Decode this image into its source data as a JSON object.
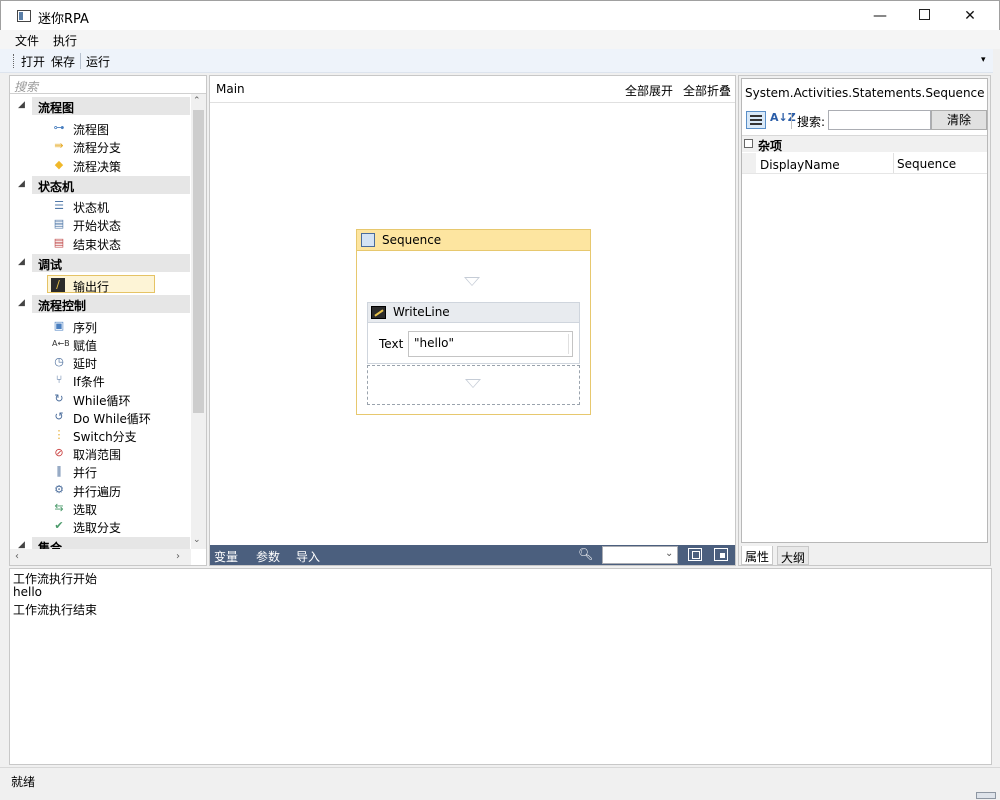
{
  "window": {
    "title": "迷你RPA",
    "minimize_glyph": "—",
    "close_glyph": "✕"
  },
  "menu": {
    "file": "文件",
    "run": "执行"
  },
  "toolbar": {
    "open": "打开",
    "save": "保存",
    "run": "运行",
    "overflow": "▾"
  },
  "toolbox": {
    "search_placeholder": "搜索",
    "categories": [
      {
        "label": "流程图",
        "items": [
          {
            "label": "流程图",
            "icon": "flowchart-icon"
          },
          {
            "label": "流程分支",
            "icon": "flow-switch-icon"
          },
          {
            "label": "流程决策",
            "icon": "flow-decision-icon"
          }
        ]
      },
      {
        "label": "状态机",
        "items": [
          {
            "label": "状态机",
            "icon": "state-machine-icon"
          },
          {
            "label": "开始状态",
            "icon": "start-state-icon"
          },
          {
            "label": "结束状态",
            "icon": "final-state-icon"
          }
        ]
      },
      {
        "label": "调试",
        "items": [
          {
            "label": "输出行",
            "icon": "writeline-icon",
            "selected": true
          }
        ]
      },
      {
        "label": "流程控制",
        "items": [
          {
            "label": "序列",
            "icon": "sequence-icon"
          },
          {
            "label": "赋值",
            "icon": "assign-icon"
          },
          {
            "label": "延时",
            "icon": "delay-icon"
          },
          {
            "label": "If条件",
            "icon": "if-icon"
          },
          {
            "label": "While循环",
            "icon": "while-icon"
          },
          {
            "label": "Do While循环",
            "icon": "do-while-icon"
          },
          {
            "label": "Switch分支",
            "icon": "switch-icon"
          },
          {
            "label": "取消范围",
            "icon": "cancel-scope-icon"
          },
          {
            "label": "并行",
            "icon": "parallel-icon"
          },
          {
            "label": "并行遍历",
            "icon": "parallel-foreach-icon"
          },
          {
            "label": "选取",
            "icon": "pick-icon"
          },
          {
            "label": "选取分支",
            "icon": "pick-branch-icon"
          }
        ]
      },
      {
        "label": "集合",
        "items": []
      }
    ]
  },
  "designer": {
    "breadcrumb": "Main",
    "expand_all": "全部展开",
    "collapse_all": "全部折叠",
    "sequence": {
      "title": "Sequence",
      "writeline": {
        "title": "WriteLine",
        "text_label": "Text",
        "text_value": "\"hello\""
      }
    },
    "footer": {
      "variables": "变量",
      "arguments": "参数",
      "imports": "导入",
      "zoom_value": ""
    }
  },
  "properties": {
    "title": "System.Activities.Statements.Sequence",
    "search_label": "搜索:",
    "search_value": "",
    "clear_button": "清除",
    "category": "杂项",
    "category_toggle": "⊟",
    "rows": [
      {
        "name": "DisplayName",
        "value": "Sequence"
      }
    ],
    "tabs": {
      "properties": "属性",
      "outline": "大纲"
    }
  },
  "output": {
    "lines": [
      "工作流执行开始",
      "hello",
      "工作流执行结束"
    ]
  },
  "status": {
    "text": "就绪"
  }
}
